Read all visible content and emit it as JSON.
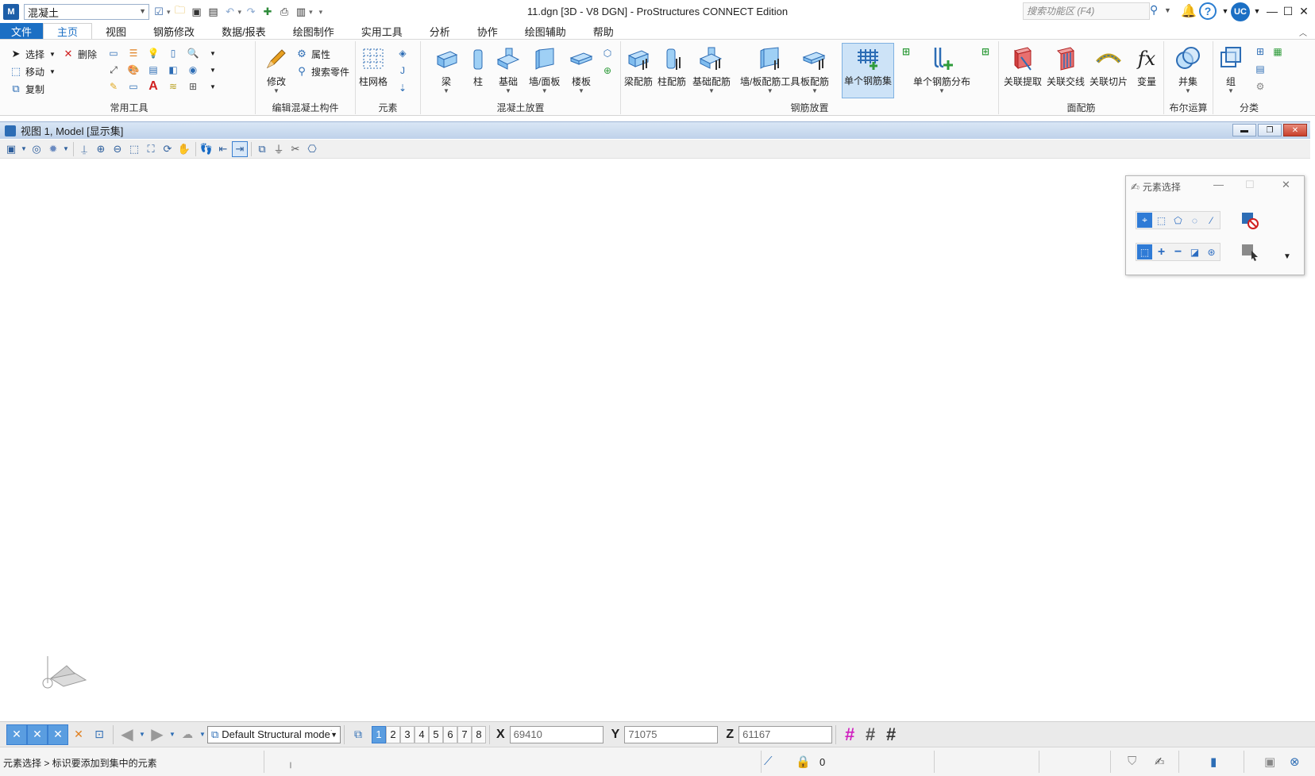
{
  "titlebar": {
    "logo_text": "M",
    "workset": "混凝土",
    "title": "11.dgn [3D - V8 DGN] - ProStructures CONNECT Edition",
    "search_placeholder": "搜索功能区 (F4)",
    "user_initials": "UC"
  },
  "menu": {
    "tabs": [
      "文件",
      "主页",
      "视图",
      "钢筋修改",
      "数据/报表",
      "绘图制作",
      "实用工具",
      "分析",
      "协作",
      "绘图辅助",
      "帮助"
    ],
    "active": "主页"
  },
  "ribbon": {
    "common_tools": {
      "label": "常用工具",
      "select": "选择",
      "move": "移动",
      "copy": "复制",
      "delete": "删除"
    },
    "edit_concrete": {
      "label": "编辑混凝土构件",
      "modify": "修改",
      "properties": "属性",
      "search_parts": "搜索零件"
    },
    "elements": {
      "label": "元素",
      "column_grid": "柱网格"
    },
    "concrete_place": {
      "label": "混凝土放置",
      "beam": "梁",
      "column": "柱",
      "foundation": "基础",
      "wall_slab": "墙/面板",
      "floor": "楼板"
    },
    "rebar_place": {
      "label": "钢筋放置",
      "beam_rebar": "梁配筋",
      "column_rebar": "柱配筋",
      "foundation_rebar": "基础配筋",
      "wall_slab_tool": "墙/板配筋工具",
      "slab_rebar": "板配筋",
      "single_rebar_set": "单个钢筋集",
      "single_rebar_dist": "单个钢筋分布"
    },
    "face_rebar": {
      "label": "面配筋",
      "assoc_extract": "关联提取",
      "assoc_intersect": "关联交线",
      "assoc_slice": "关联切片",
      "variable": "变量"
    },
    "boolean": {
      "label": "布尔运算",
      "union": "并集"
    },
    "classify": {
      "label": "分类",
      "group": "组"
    }
  },
  "view": {
    "title": "视图 1, Model [显示集]"
  },
  "selection_panel": {
    "title": "元素选择"
  },
  "bottom": {
    "model": "Default Structural model",
    "view_numbers": [
      "1",
      "2",
      "3",
      "4",
      "5",
      "6",
      "7",
      "8"
    ],
    "active_view": "1",
    "x_label": "X",
    "x_value": "69410",
    "y_label": "Y",
    "y_value": "71075",
    "z_label": "Z",
    "z_value": "61167"
  },
  "status": {
    "prompt": "元素选择 > 标识要添加到集中的元素",
    "lock_count": "0"
  },
  "colors": {
    "accent": "#1b6fc4",
    "view_title_bg": "#c9d9ee",
    "rebar_green": "#2e9b3a"
  }
}
